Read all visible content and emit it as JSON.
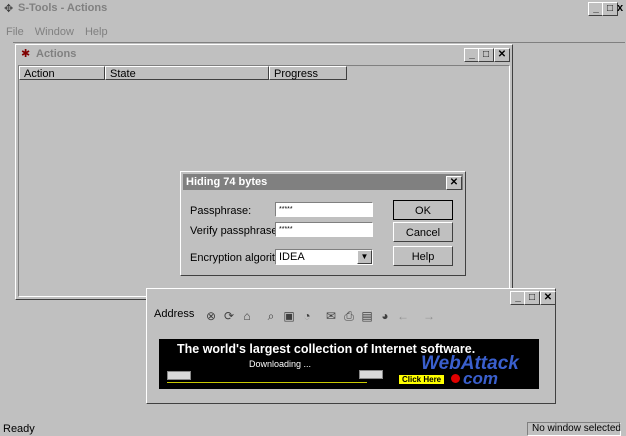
{
  "app": {
    "title": "S-Tools - Actions",
    "menu": [
      "File",
      "Window",
      "Help"
    ]
  },
  "actions_window": {
    "title": "Actions",
    "columns": [
      "Action",
      "State",
      "Progress"
    ]
  },
  "dialog": {
    "title": "Hiding 74 bytes",
    "passphrase_label": "Passphrase:",
    "passphrase_value": "*****",
    "verify_label": "Verify passphrase:",
    "verify_value": "*****",
    "algorithm_label": "Encryption algorithm:",
    "algorithm_value": "IDEA",
    "ok_label": "OK",
    "cancel_label": "Cancel",
    "help_label": "Help"
  },
  "browser": {
    "address_label": "Address",
    "banner_headline": "The world's largest collection of Internet software.",
    "banner_downloading": "Downloading ...",
    "banner_brand_top": "WebAttack",
    "banner_brand_bottom": "com",
    "banner_click": "Click Here"
  },
  "status": {
    "left": "Ready",
    "right": "No window selected"
  },
  "colors": {
    "active_title": "#000080",
    "inactive_title": "#808080",
    "banner_bg": "#000000",
    "brand_blue": "#3a5fcd",
    "click_yellow": "#ffff00"
  }
}
